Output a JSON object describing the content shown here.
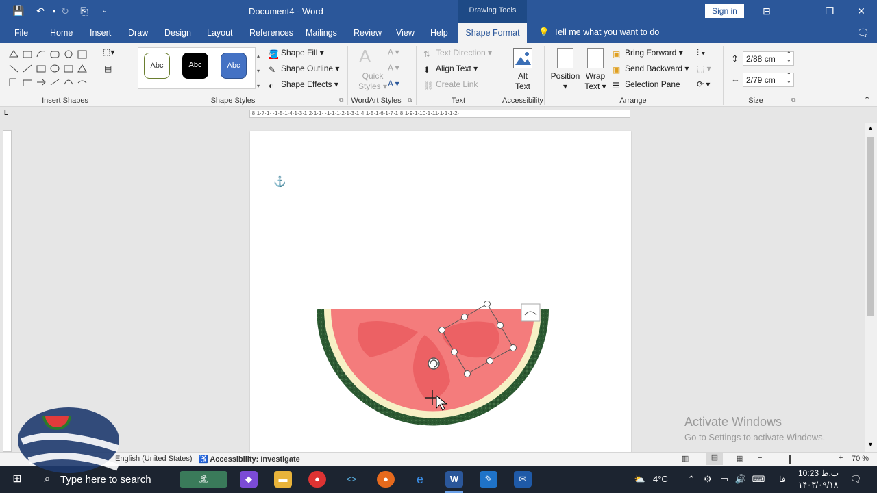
{
  "titlebar": {
    "doc_title": "Document4 - Word",
    "context_group": "Drawing Tools",
    "signin_label": "Sign in"
  },
  "tabs": [
    "File",
    "Home",
    "Insert",
    "Draw",
    "Design",
    "Layout",
    "References",
    "Mailings",
    "Review",
    "View",
    "Help"
  ],
  "active_tab": "Shape Format",
  "tellme": "Tell me what you want to do",
  "ribbon": {
    "groups": {
      "insert_shapes": "Insert Shapes",
      "shape_styles": "Shape Styles",
      "wordart_styles": "WordArt Styles",
      "text": "Text",
      "accessibility": "Accessibility",
      "arrange": "Arrange",
      "size": "Size"
    },
    "style_swatches": [
      "Abc",
      "Abc",
      "Abc"
    ],
    "shape_fill": "Shape Fill",
    "shape_outline": "Shape Outline",
    "shape_effects": "Shape Effects",
    "quick_styles_1": "Quick",
    "quick_styles_2": "Styles",
    "text_direction": "Text Direction",
    "align_text": "Align Text",
    "create_link": "Create Link",
    "alt_text_1": "Alt",
    "alt_text_2": "Text",
    "position": "Position",
    "wrap_text_1": "Wrap",
    "wrap_text_2": "Text",
    "bring_forward": "Bring Forward",
    "send_backward": "Send Backward",
    "selection_pane": "Selection Pane",
    "height_value": "2/88 cm",
    "width_value": "2/79 cm"
  },
  "ruler_text": "·8·1·7·1·  ·1·5·1·4·1·3·1·2·1·1· ·1·1·1·2·1·3·1·4·1·5·1·6·1·7·1·8·1·9·1·10·1·11·1·1·1·2·",
  "watermark": {
    "line1": "Activate Windows",
    "line2": "Go to Settings to activate Windows."
  },
  "statusbar": {
    "language": "English (United States)",
    "accessibility": "Accessibility: Investigate",
    "zoom": "70 %"
  },
  "taskbar": {
    "search": "Type here to search",
    "temperature": "4°C",
    "lang": "ﻓﺎ",
    "time": "10:23 ب.ظ",
    "date": "۱۴۰۳/۰۹/۱۸"
  },
  "colors": {
    "word_blue": "#2b579a",
    "watermelon_flesh": "#f47c7c",
    "rind": "#2c5a32"
  }
}
